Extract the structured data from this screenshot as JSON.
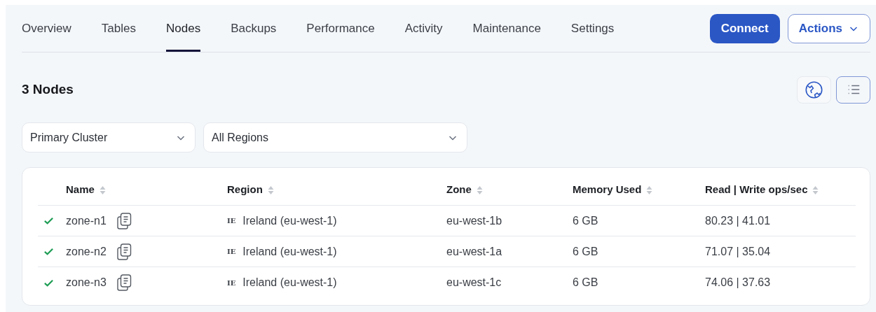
{
  "tabs": [
    {
      "label": "Overview",
      "selected": false
    },
    {
      "label": "Tables",
      "selected": false
    },
    {
      "label": "Nodes",
      "selected": true
    },
    {
      "label": "Backups",
      "selected": false
    },
    {
      "label": "Performance",
      "selected": false
    },
    {
      "label": "Activity",
      "selected": false
    },
    {
      "label": "Maintenance",
      "selected": false
    },
    {
      "label": "Settings",
      "selected": false
    }
  ],
  "buttons": {
    "connect": "Connect",
    "actions": "Actions"
  },
  "heading": "3 Nodes",
  "view_toggle": [
    {
      "kind": "map",
      "selected": false
    },
    {
      "kind": "list",
      "selected": true
    }
  ],
  "filters": [
    {
      "value": "Primary Cluster"
    },
    {
      "value": "All Regions"
    }
  ],
  "table": {
    "columns": [
      "Name",
      "Region",
      "Zone",
      "Memory Used",
      "Read | Write ops/sec"
    ],
    "rows": [
      {
        "healthy": true,
        "name": "zone-n1",
        "country": "IE",
        "region": "Ireland (eu-west-1)",
        "zone": "eu-west-1b",
        "memory": "6 GB",
        "ops": "80.23 | 41.01"
      },
      {
        "healthy": true,
        "name": "zone-n2",
        "country": "IE",
        "region": "Ireland (eu-west-1)",
        "zone": "eu-west-1a",
        "memory": "6 GB",
        "ops": "71.07 | 35.04"
      },
      {
        "healthy": true,
        "name": "zone-n3",
        "country": "IE",
        "region": "Ireland (eu-west-1)",
        "zone": "eu-west-1c",
        "memory": "6 GB",
        "ops": "74.06 | 37.63"
      }
    ]
  }
}
